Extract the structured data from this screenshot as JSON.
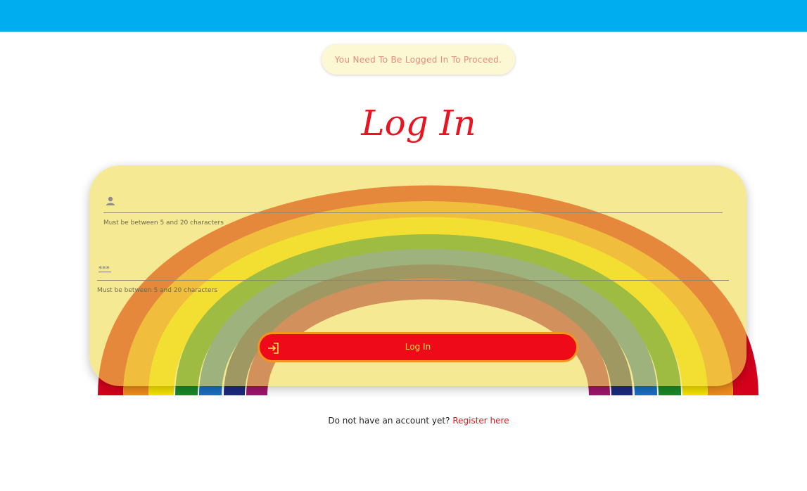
{
  "alert": {
    "message": "You Need To Be Logged In To Proceed."
  },
  "page": {
    "title": "Log In"
  },
  "form": {
    "username": {
      "value": "",
      "placeholder": "",
      "icon": "user-icon",
      "hint": "Must be between 5 and 20 characters"
    },
    "password": {
      "value": "",
      "placeholder": "",
      "icon": "password-icon",
      "hint": "Must be between 5 and 20 characters"
    },
    "submit": {
      "label": "Log In",
      "icon": "login-icon"
    }
  },
  "register": {
    "prompt": "Do not have an account yet?",
    "link_label": "Register here"
  },
  "colors": {
    "topbar": "#00adee",
    "accent_red": "#ee0a19",
    "button_border": "#f7941d",
    "button_text": "#f8e04c",
    "card_fill": "#f0dc50"
  }
}
